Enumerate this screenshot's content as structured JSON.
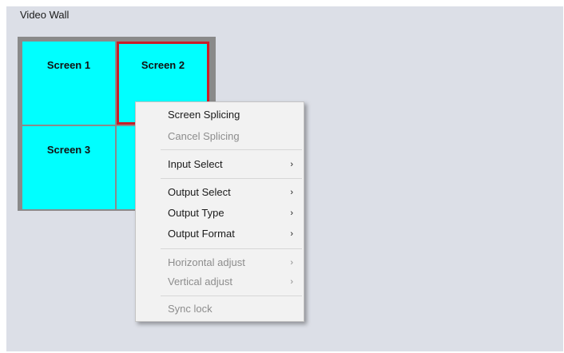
{
  "panel": {
    "title": "Video Wall"
  },
  "wall": {
    "screens": [
      {
        "label": "Screen 1",
        "selected": false,
        "color": "#00ffff"
      },
      {
        "label": "Screen 2",
        "selected": true,
        "color": "#00ffff"
      },
      {
        "label": "Screen 3",
        "selected": false,
        "color": "#00ffff"
      },
      {
        "label": "",
        "selected": false,
        "color": "#00ffff"
      }
    ],
    "selected_border_color": "#c81e28"
  },
  "context_menu": {
    "items": [
      {
        "label": "Screen Splicing",
        "enabled": true,
        "submenu": false
      },
      {
        "label": "Cancel Splicing",
        "enabled": false,
        "submenu": false
      },
      {
        "label": "Input Select",
        "enabled": true,
        "submenu": true,
        "arrow": "›"
      },
      {
        "label": "Output Select",
        "enabled": true,
        "submenu": true,
        "arrow": "›"
      },
      {
        "label": "Output Type",
        "enabled": true,
        "submenu": true,
        "arrow": "›"
      },
      {
        "label": "Output Format",
        "enabled": true,
        "submenu": true,
        "arrow": "›"
      },
      {
        "label": "Horizontal adjust",
        "enabled": false,
        "submenu": true,
        "arrow": "›"
      },
      {
        "label": "Vertical adjust",
        "enabled": false,
        "submenu": true,
        "arrow": "›"
      },
      {
        "label": "Sync lock",
        "enabled": false,
        "submenu": false
      }
    ]
  }
}
